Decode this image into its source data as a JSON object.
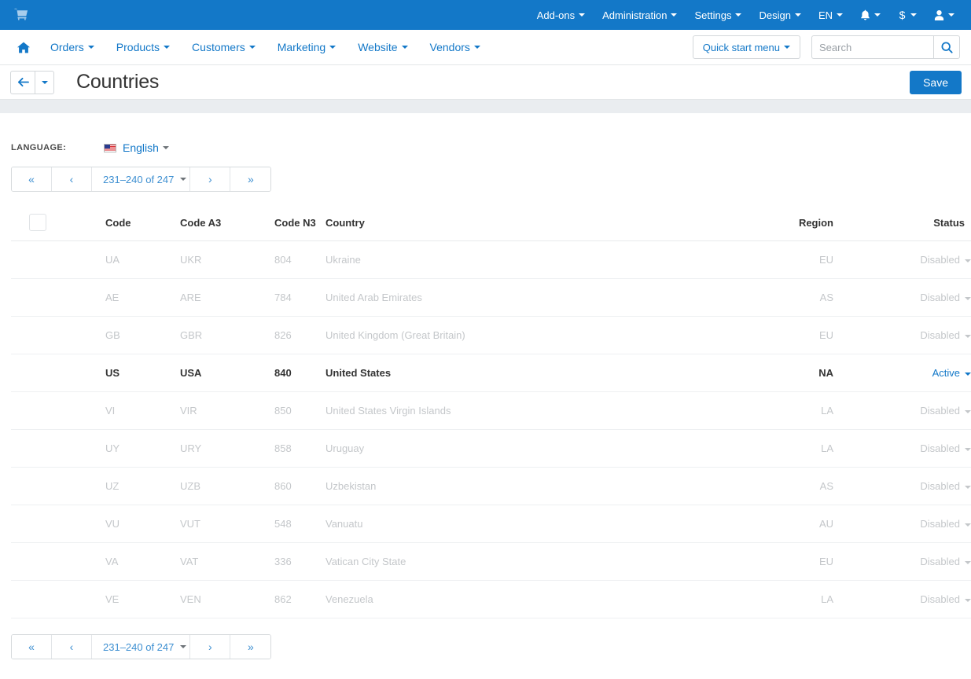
{
  "topbar": {
    "logo_icon": "shopping-cart-icon",
    "menus": [
      {
        "label": "Add-ons",
        "icon": null
      },
      {
        "label": "Administration",
        "icon": null
      },
      {
        "label": "Settings",
        "icon": null
      },
      {
        "label": "Design",
        "icon": null
      },
      {
        "label": "EN",
        "icon": null
      }
    ],
    "icon_menus": [
      {
        "icon": "bell-icon",
        "name": "notifications-menu"
      },
      {
        "icon": "dollar-icon",
        "name": "currency-menu"
      },
      {
        "icon": "user-icon",
        "name": "account-menu"
      }
    ]
  },
  "navbar": {
    "home_icon": "home-icon",
    "items": [
      {
        "label": "Orders"
      },
      {
        "label": "Products"
      },
      {
        "label": "Customers"
      },
      {
        "label": "Marketing"
      },
      {
        "label": "Website"
      },
      {
        "label": "Vendors"
      }
    ],
    "quick_start_label": "Quick start menu",
    "search": {
      "placeholder": "Search",
      "value": "",
      "icon": "search-icon"
    }
  },
  "titlebar": {
    "back_icon": "arrow-left-icon",
    "title": "Countries",
    "save_label": "Save"
  },
  "language": {
    "label": "LANGUAGE:",
    "flag": "us-flag-icon",
    "selected": "English"
  },
  "pagination": {
    "first_label": "«",
    "prev_label": "‹",
    "range_label": "231–240 of 247",
    "next_label": "›",
    "last_label": "»"
  },
  "table": {
    "columns": [
      {
        "key": "checkbox",
        "label": ""
      },
      {
        "key": "code",
        "label": "Code"
      },
      {
        "key": "code_a3",
        "label": "Code A3"
      },
      {
        "key": "code_n3",
        "label": "Code N3"
      },
      {
        "key": "country",
        "label": "Country"
      },
      {
        "key": "region",
        "label": "Region"
      },
      {
        "key": "status",
        "label": "Status"
      }
    ],
    "rows": [
      {
        "code": "UA",
        "code_a3": "UKR",
        "code_n3": "804",
        "country": "Ukraine",
        "region": "EU",
        "status": "Disabled",
        "active": false
      },
      {
        "code": "AE",
        "code_a3": "ARE",
        "code_n3": "784",
        "country": "United Arab Emirates",
        "region": "AS",
        "status": "Disabled",
        "active": false
      },
      {
        "code": "GB",
        "code_a3": "GBR",
        "code_n3": "826",
        "country": "United Kingdom (Great Britain)",
        "region": "EU",
        "status": "Disabled",
        "active": false
      },
      {
        "code": "US",
        "code_a3": "USA",
        "code_n3": "840",
        "country": "United States",
        "region": "NA",
        "status": "Active",
        "active": true
      },
      {
        "code": "VI",
        "code_a3": "VIR",
        "code_n3": "850",
        "country": "United States Virgin Islands",
        "region": "LA",
        "status": "Disabled",
        "active": false
      },
      {
        "code": "UY",
        "code_a3": "URY",
        "code_n3": "858",
        "country": "Uruguay",
        "region": "LA",
        "status": "Disabled",
        "active": false
      },
      {
        "code": "UZ",
        "code_a3": "UZB",
        "code_n3": "860",
        "country": "Uzbekistan",
        "region": "AS",
        "status": "Disabled",
        "active": false
      },
      {
        "code": "VU",
        "code_a3": "VUT",
        "code_n3": "548",
        "country": "Vanuatu",
        "region": "AU",
        "status": "Disabled",
        "active": false
      },
      {
        "code": "VA",
        "code_a3": "VAT",
        "code_n3": "336",
        "country": "Vatican City State",
        "region": "EU",
        "status": "Disabled",
        "active": false
      },
      {
        "code": "VE",
        "code_a3": "VEN",
        "code_n3": "862",
        "country": "Venezuela",
        "region": "LA",
        "status": "Disabled",
        "active": false
      }
    ]
  },
  "colors": {
    "brand_blue": "#1378c8",
    "link_blue": "#3d8fd1",
    "disabled_grey": "#c4c7ca",
    "band_grey": "#eaedf0"
  }
}
